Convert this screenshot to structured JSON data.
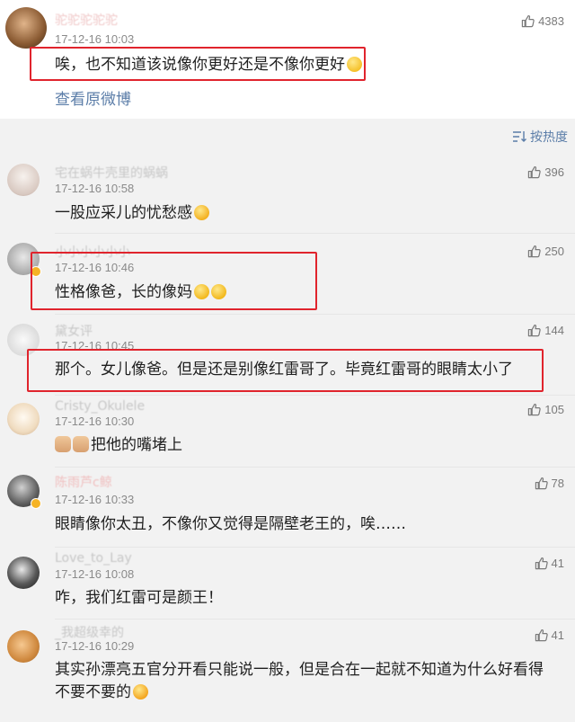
{
  "top": {
    "username": "驼驼驼驼驼",
    "time": "17-12-16 10:03",
    "likes": "4383",
    "text": "唉，也不知道该说像你更好还是不像你更好",
    "view_original": "查看原微博"
  },
  "sort": {
    "label": "按热度"
  },
  "comments": [
    {
      "username": "宅在蜗牛壳里的蜗蜗",
      "time": "17-12-16 10:58",
      "likes": "396",
      "text": "一股应采儿的忧愁感"
    },
    {
      "username": "小小小小小小",
      "time": "17-12-16 10:46",
      "likes": "250",
      "text": "性格像爸，长的像妈"
    },
    {
      "username": "黛女评",
      "time": "17-12-16 10:45",
      "likes": "144",
      "text": "那个。女儿像爸。但是还是别像红雷哥了。毕竟红雷哥的眼睛太小了"
    },
    {
      "username": "Cristy_Okulele",
      "time": "17-12-16 10:30",
      "likes": "105",
      "text": "把他的嘴堵上"
    },
    {
      "username": "陈雨芦c鲸",
      "time": "17-12-16 10:33",
      "likes": "78",
      "text": "眼睛像你太丑，不像你又觉得是隔壁老王的，唉……"
    },
    {
      "username": "Love_to_Lay",
      "time": "17-12-16 10:08",
      "likes": "41",
      "text": "咋，我们红雷可是颜王！"
    },
    {
      "username": "_我超级幸的",
      "time": "17-12-16 10:29",
      "likes": "41",
      "text": "其实孙漂亮五官分开看只能说一般，但是合在一起就不知道为什么好看得",
      "text2": "不要不要的"
    }
  ],
  "colors": {
    "highlight": "#e0242d",
    "link": "#5b7da8",
    "background": "#f2f2f2"
  }
}
